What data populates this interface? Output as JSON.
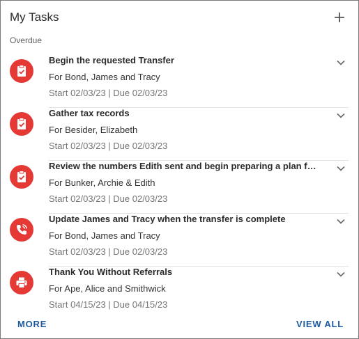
{
  "card": {
    "title": "My Tasks",
    "add_label": "+",
    "section_label": "Overdue"
  },
  "tasks": [
    {
      "title": "Begin the requested Transfer",
      "for": "For Bond, James and Tracy",
      "dates": "Start 02/03/23 | Due 02/03/23",
      "icon": "clipboard-check-icon"
    },
    {
      "title": "Gather tax records",
      "for": "For Besider, Elizabeth",
      "dates": "Start 02/03/23 | Due 02/03/23",
      "icon": "clipboard-check-icon"
    },
    {
      "title": "Review the numbers Edith sent and begin preparing a plan for …",
      "for": "For Bunker, Archie & Edith",
      "dates": "Start 02/03/23 | Due 02/03/23",
      "icon": "clipboard-check-icon"
    },
    {
      "title": "Update James and Tracy when the transfer is complete",
      "for": "For Bond, James and Tracy",
      "dates": "Start 02/03/23 | Due 02/03/23",
      "icon": "phone-call-icon"
    },
    {
      "title": "Thank You Without Referrals",
      "for": "For Ape, Alice and Smithwick",
      "dates": "Start 04/15/23 | Due 04/15/23",
      "icon": "printer-icon"
    }
  ],
  "footer": {
    "more_label": "MORE",
    "view_all_label": "VIEW ALL"
  },
  "colors": {
    "icon_bg": "#e53935",
    "link": "#1e5aa0"
  }
}
